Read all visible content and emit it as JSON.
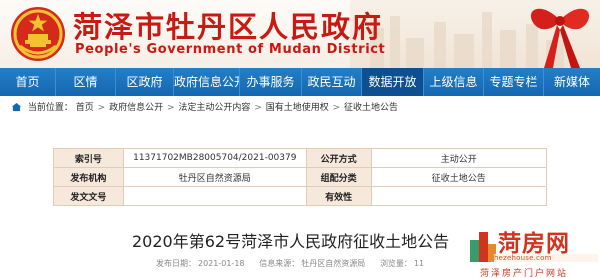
{
  "header": {
    "title": "菏泽市牡丹区人民政府",
    "subtitle": "People's Government of Mudan District"
  },
  "nav": {
    "items": [
      {
        "label": "首页"
      },
      {
        "label": "区情"
      },
      {
        "label": "区政府"
      },
      {
        "label": "政府信息公开"
      },
      {
        "label": "办事服务"
      },
      {
        "label": "政民互动"
      },
      {
        "label": "数据开放",
        "active": true
      },
      {
        "label": "上级信息"
      },
      {
        "label": "专题专栏"
      },
      {
        "label": "新媒体"
      }
    ]
  },
  "breadcrumb": {
    "prefix": "当前位置：",
    "items": [
      "首页",
      "政府信息公开",
      "法定主动公开内容",
      "国有土地使用权",
      "征收土地公告"
    ]
  },
  "info_table": {
    "index_label": "索引号",
    "index_value": "11371702MB28005704/2021-00379",
    "disclosure_label": "公开方式",
    "disclosure_value": "主动公开",
    "publisher_label": "发布机构",
    "publisher_value": "牡丹区自然资源局",
    "category_label": "组配分类",
    "category_value": "征收土地公告",
    "doc_no_label": "发文文号",
    "doc_no_value": "",
    "validity_label": "有效性",
    "validity_value": ""
  },
  "article": {
    "title": "2020年第62号菏泽市人民政府征收土地公告",
    "date_label": "发布日期：",
    "date": "2021-01-18",
    "source_label": "信息来源：",
    "source": "牡丹区自然资源局",
    "views_label": "浏览量：",
    "views": "11"
  },
  "watermark": {
    "name": "菏房网",
    "domain": "hezehouse.com",
    "tagline": "菏泽房产门户网站"
  },
  "colors": {
    "brand_red": "#c81a12",
    "nav_blue": "#1467b0",
    "nav_active": "#0d4f91",
    "table_label_bg": "#f6e9dc"
  }
}
